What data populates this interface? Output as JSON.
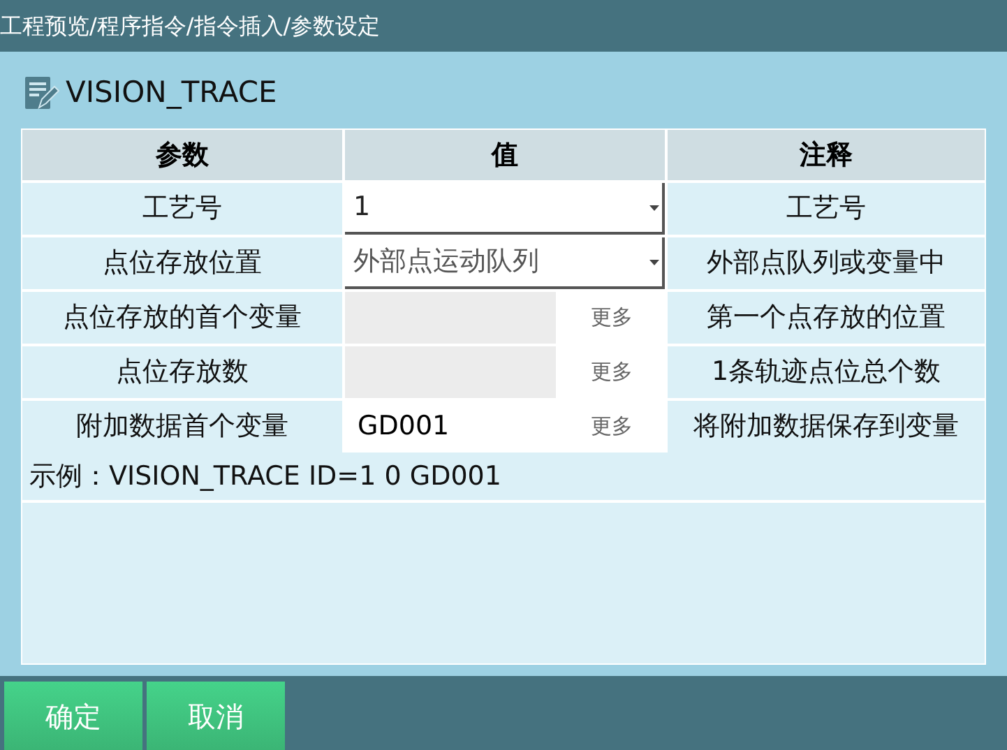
{
  "window": {
    "title": "工程预览/程序指令/指令插入/参数设定"
  },
  "heading": "VISION_TRACE",
  "table": {
    "columns": [
      "参数",
      "值",
      "注释"
    ],
    "rows": [
      {
        "kind": "select",
        "param": "工艺号",
        "value": "1",
        "note": "工艺号"
      },
      {
        "kind": "select",
        "param": "点位存放位置",
        "value": "外部点运动队列",
        "note": "外部点队列或变量中"
      },
      {
        "kind": "variable",
        "param": "点位存放的首个变量",
        "disabled": true,
        "more": "更多",
        "note": "第一个点存放的位置"
      },
      {
        "kind": "variable",
        "param": "点位存放数",
        "disabled": true,
        "more": "更多",
        "note": "1条轨迹点位总个数"
      },
      {
        "kind": "variable",
        "param": "附加数据首个变量",
        "value": "GD001",
        "disabled": false,
        "more": "更多",
        "note": "将附加数据保存到变量"
      }
    ]
  },
  "example": "示例：VISION_TRACE ID=1 0 GD001",
  "buttons": [
    "确定",
    "取消"
  ]
}
